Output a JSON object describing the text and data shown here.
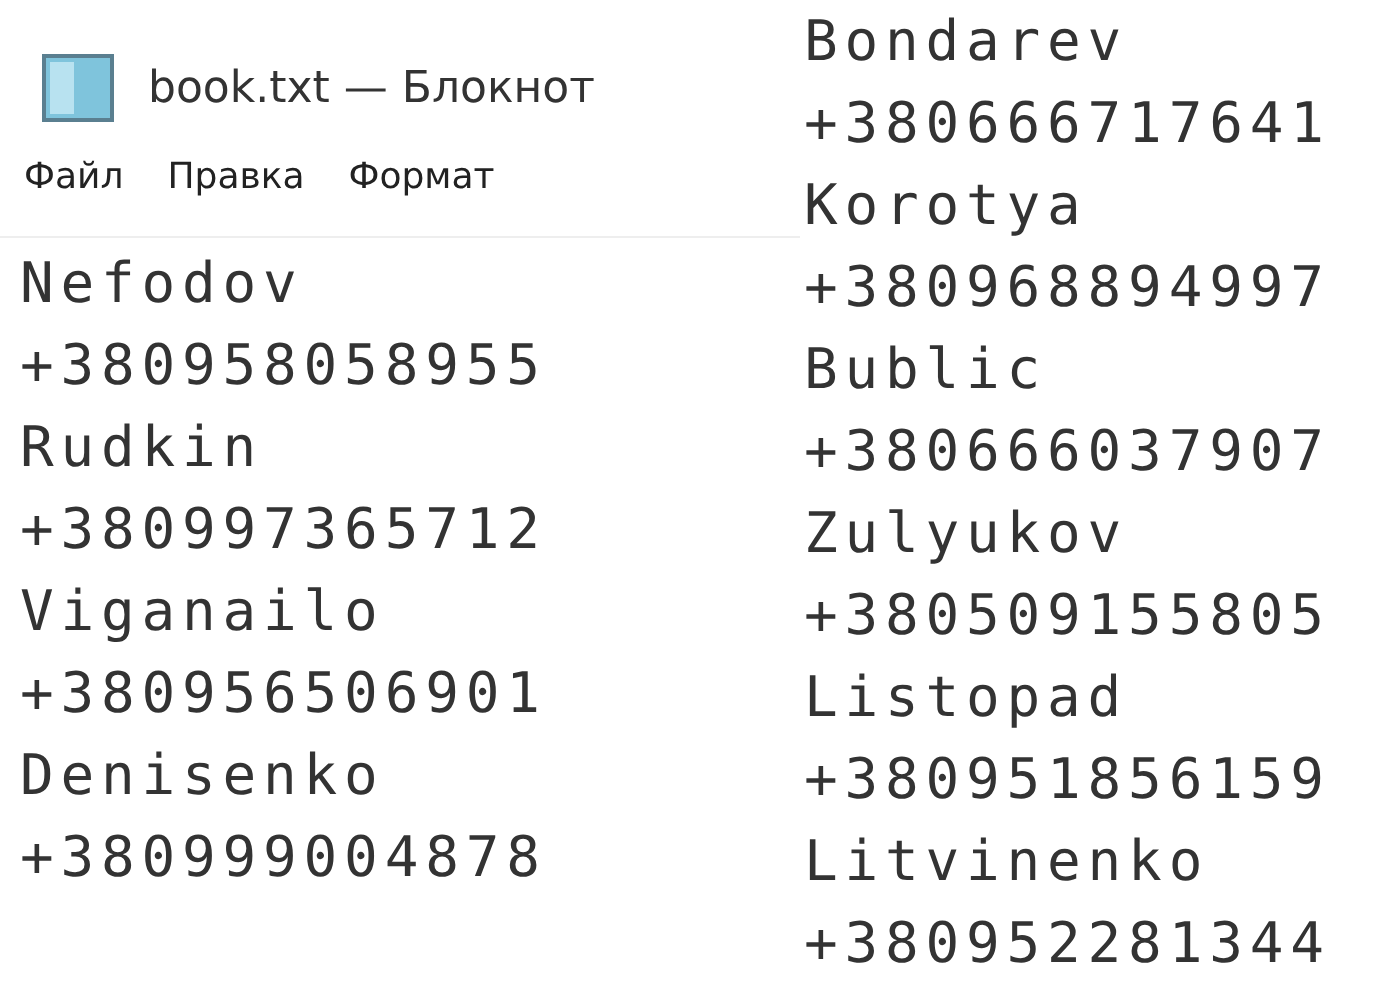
{
  "window": {
    "title": "book.txt — Блокнот"
  },
  "menu": [
    "Файл",
    "Правка",
    "Формат"
  ],
  "left_lines": [
    "Nefodov",
    "+380958058955",
    "Rudkin",
    "+380997365712",
    "Viganailo",
    "+380956506901",
    "Denisenko",
    "+380999004878"
  ],
  "right_lines": [
    "Bondarev",
    "+380666717641",
    "Korotya",
    "+380968894997",
    "Bublic",
    "+380666037907",
    "Zulyukov",
    "+380509155805",
    "Listopad",
    "+380951856159",
    "Litvinenko",
    "+380952281344"
  ]
}
